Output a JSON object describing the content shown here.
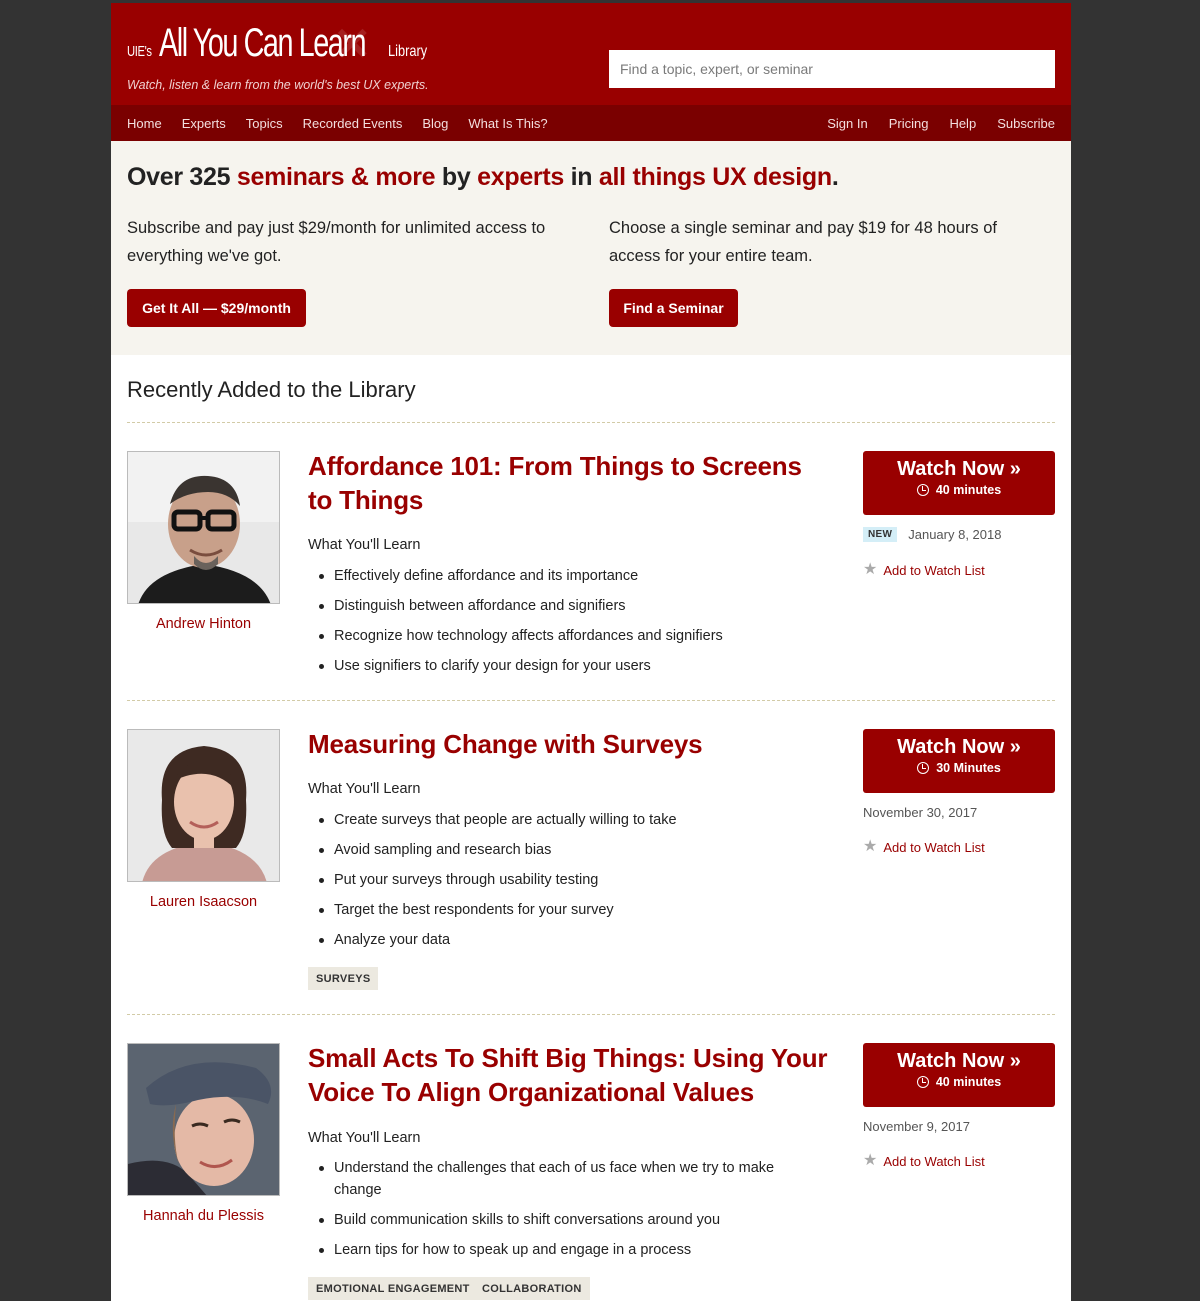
{
  "header": {
    "logo_pre": "UIE's",
    "logo_main": "All You Can Learn",
    "logo_post": "Library",
    "tagline": "Watch, listen & learn from the world's best UX experts.",
    "search_placeholder": "Find a topic, expert, or seminar"
  },
  "nav": {
    "left": [
      "Home",
      "Experts",
      "Topics",
      "Recorded Events",
      "Blog",
      "What Is This?"
    ],
    "right": [
      "Sign In",
      "Pricing",
      "Help",
      "Subscribe"
    ]
  },
  "hero": {
    "headline": {
      "t1": "Over 325 ",
      "t2": "seminars & more",
      "t3": " by ",
      "t4": "experts",
      "t5": " in ",
      "t6": "all things UX design",
      "t7": "."
    },
    "left_text": "Subscribe and pay just $29/month for unlimited access to everything we've got.",
    "right_text": "Choose a single seminar and pay $19 for 48 hours of access for your entire team.",
    "left_button": "Get It All — $29/month",
    "right_button": "Find a Seminar"
  },
  "recent": {
    "heading": "Recently Added to the Library",
    "what_youll_learn": "What You'll Learn",
    "add_to_watch_list": "Add to Watch List",
    "watch_now": "Watch Now »",
    "items": [
      {
        "title": "Affordance 101: From Things to Screens to Things",
        "author": "Andrew Hinton",
        "duration": "40 minutes",
        "badge": "NEW",
        "date": "January 8, 2018",
        "learn": [
          "Effectively define affordance and its importance",
          "Distinguish between affordance and signifiers",
          "Recognize how technology affects affordances and signifiers",
          "Use signifiers to clarify your design for your users"
        ],
        "tags": []
      },
      {
        "title": "Measuring Change with Surveys",
        "author": "Lauren Isaacson",
        "duration": "30 Minutes",
        "badge": "",
        "date": "November 30, 2017",
        "learn": [
          "Create surveys that people are actually willing to take",
          "Avoid sampling and research bias",
          "Put your surveys through usability testing",
          "Target the best respondents for your survey",
          "Analyze your data"
        ],
        "tags": [
          "SURVEYS"
        ]
      },
      {
        "title": "Small Acts To Shift Big Things: Using Your Voice To Align Organizational Values",
        "author": "Hannah du Plessis",
        "duration": "40 minutes",
        "badge": "",
        "date": "November 9, 2017",
        "learn": [
          "Understand the challenges that each of us face when we try to make change",
          "Build communication skills to shift conversations around you",
          "Learn tips for how to speak up and engage in a process"
        ],
        "tags": [
          "EMOTIONAL ENGAGEMENT",
          "COLLABORATION"
        ]
      }
    ]
  },
  "colors": {
    "brand": "#990000",
    "nav": "#7a0000",
    "hero_bg": "#f6f4ee",
    "background": "#333333"
  }
}
